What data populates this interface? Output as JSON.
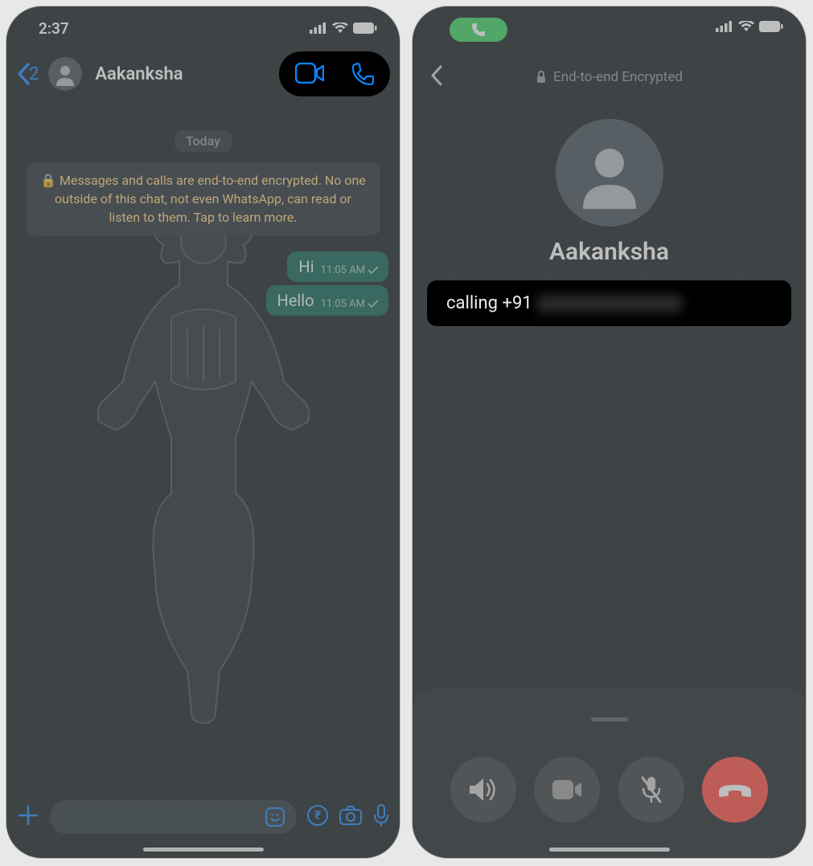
{
  "left": {
    "status_time": "2:37",
    "back_count": "2",
    "contact_name": "Aakanksha",
    "date_label": "Today",
    "encryption_notice": "🔒 Messages and calls are end-to-end encrypted. No one outside of this chat, not even WhatsApp, can read or listen to them. Tap to learn more.",
    "messages": [
      {
        "text": "Hi",
        "time": "11:05 AM"
      },
      {
        "text": "Hello",
        "time": "11:05 AM"
      }
    ]
  },
  "right": {
    "encryption_label": "End-to-end Encrypted",
    "contact_name": "Aakanksha",
    "calling_prefix": "calling +91"
  }
}
